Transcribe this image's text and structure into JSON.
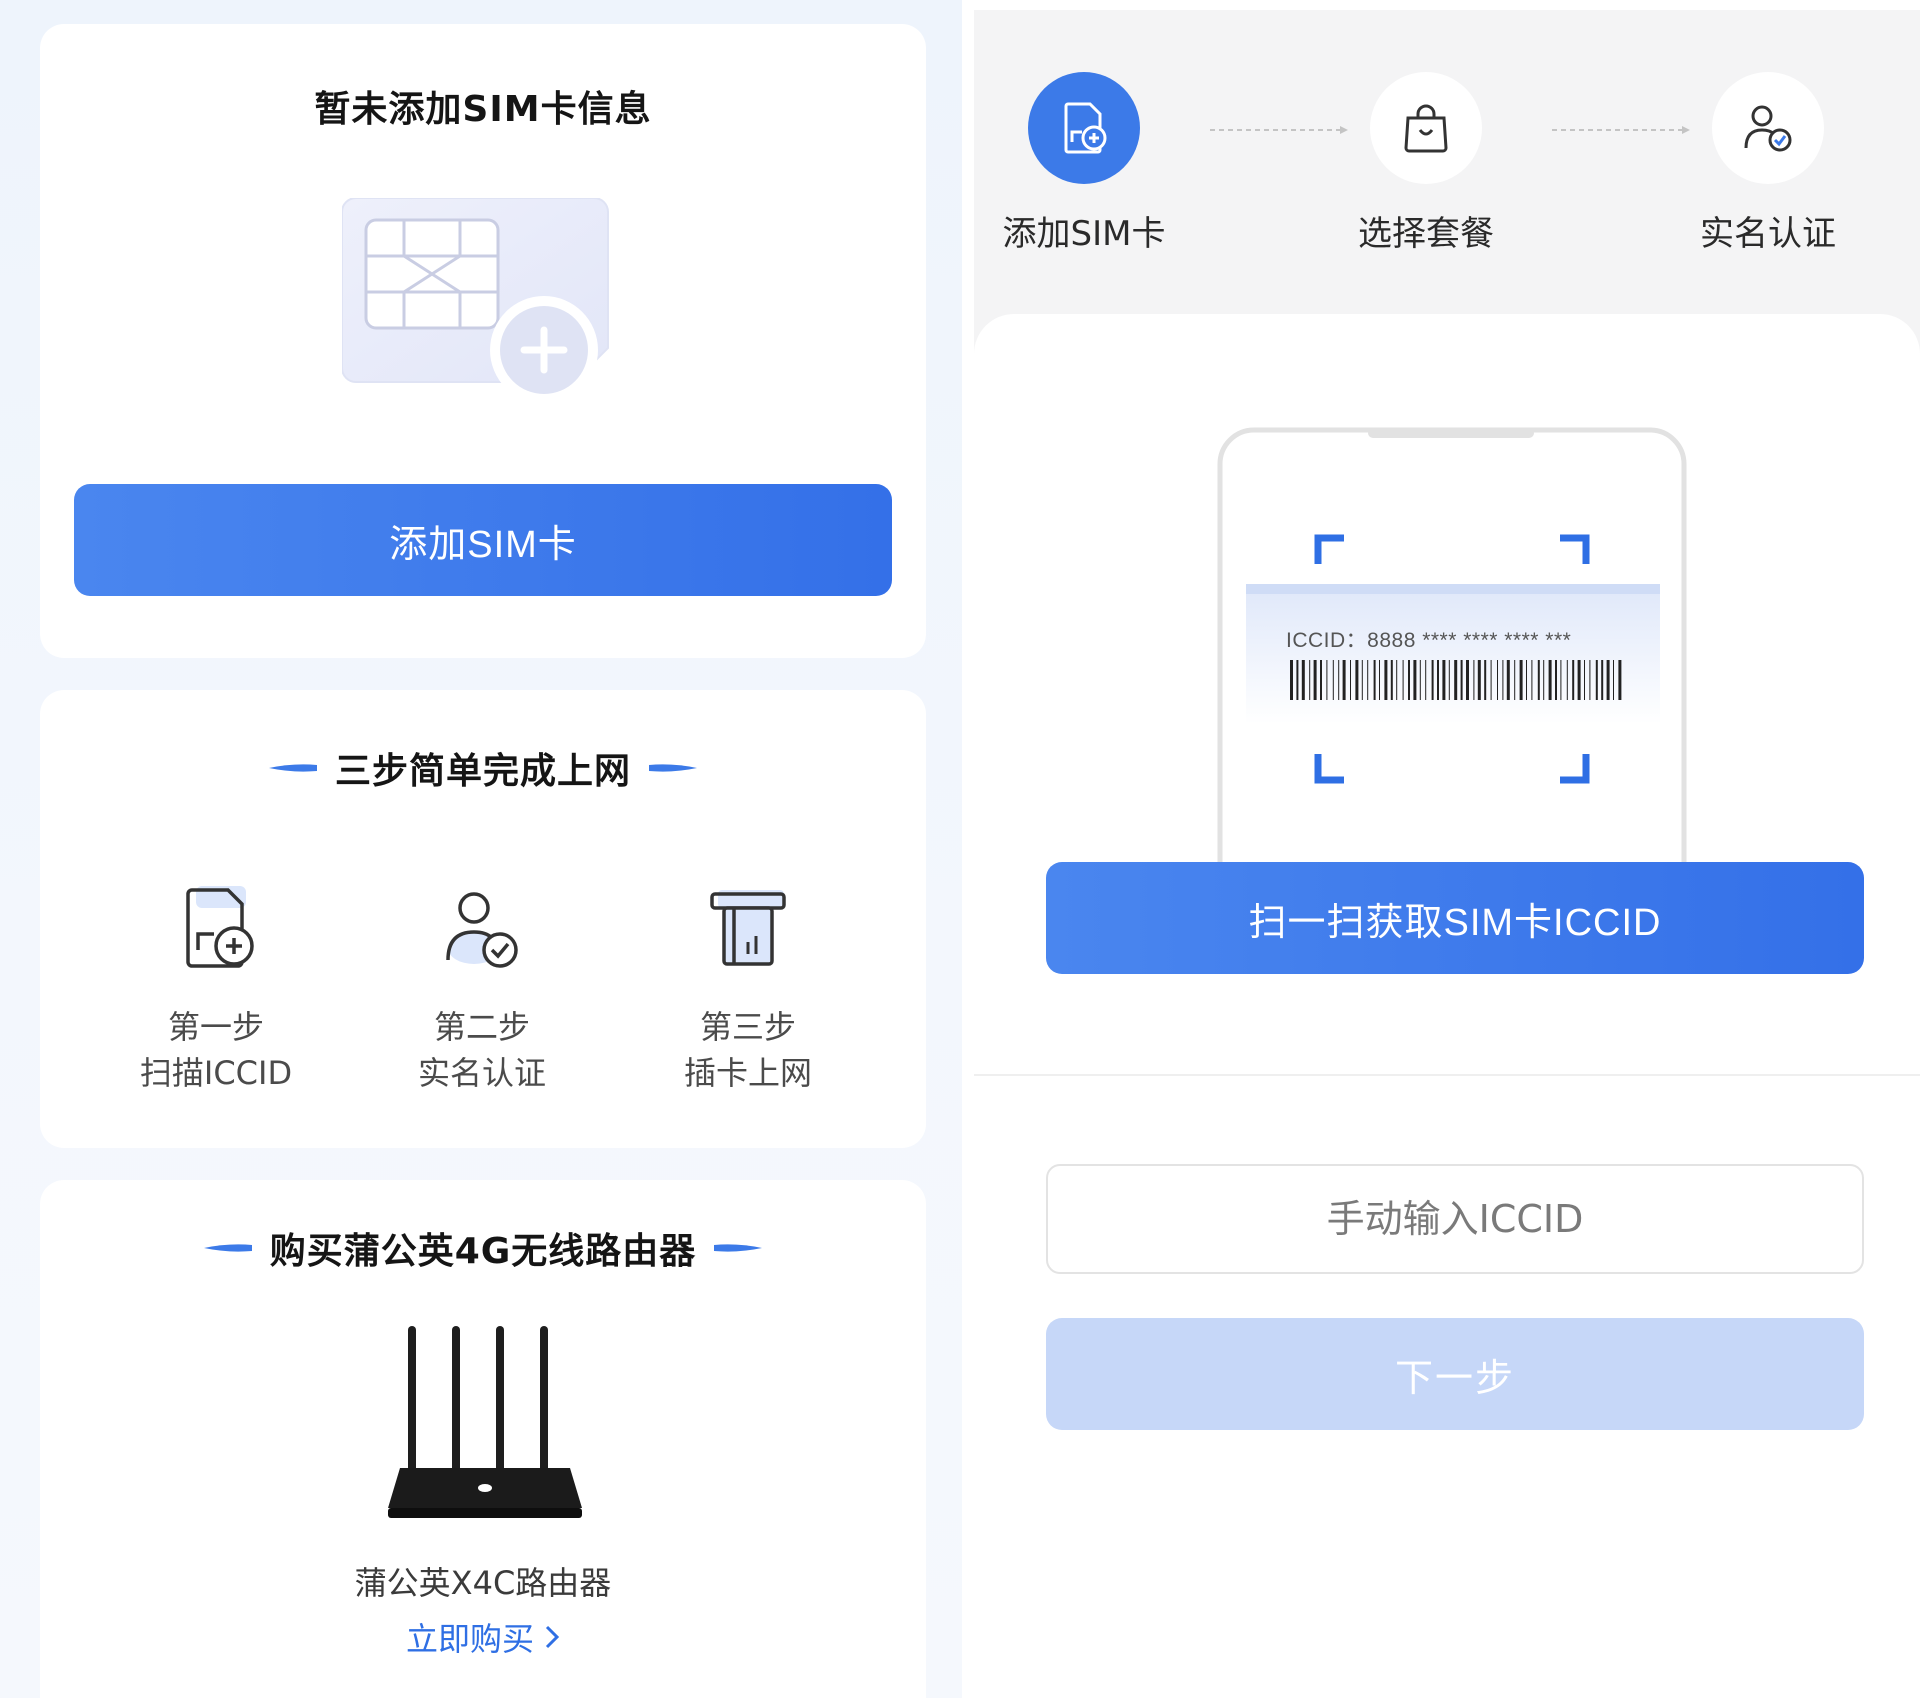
{
  "left": {
    "sim_card": {
      "title": "暂未添加SIM卡信息",
      "add_button_label": "添加SIM卡"
    },
    "steps_section": {
      "title": "三步简单完成上网",
      "steps": [
        {
          "line1": "第一步",
          "line2": "扫描ICCID",
          "icon": "sim-add-icon"
        },
        {
          "line1": "第二步",
          "line2": "实名认证",
          "icon": "user-verify-icon"
        },
        {
          "line1": "第三步",
          "line2": "插卡上网",
          "icon": "insert-card-icon"
        }
      ]
    },
    "buy_section": {
      "title": "购买蒲公英4G无线路由器",
      "product_name": "蒲公英X4C路由器",
      "buy_link": "立即购买"
    }
  },
  "right": {
    "progress": {
      "steps": [
        {
          "label": "添加SIM卡",
          "icon": "sim-add-icon",
          "active": true
        },
        {
          "label": "选择套餐",
          "icon": "shopping-bag-icon",
          "active": false
        },
        {
          "label": "实名认证",
          "icon": "user-verify-icon",
          "active": false
        }
      ]
    },
    "scan": {
      "iccid_sample": "ICCID：8888 **** **** **** ***",
      "scan_button_label": "扫一扫获取SIM卡ICCID"
    },
    "manual": {
      "input_placeholder": "手动输入ICCID",
      "input_value": "",
      "next_button_label": "下一步"
    }
  },
  "colors": {
    "accent": "#3c7ae8",
    "button_gradient_start": "#4a86ef",
    "button_gradient_end": "#3470e8",
    "disabled_button": "#c6d7f8",
    "link": "#2f6fe4"
  }
}
